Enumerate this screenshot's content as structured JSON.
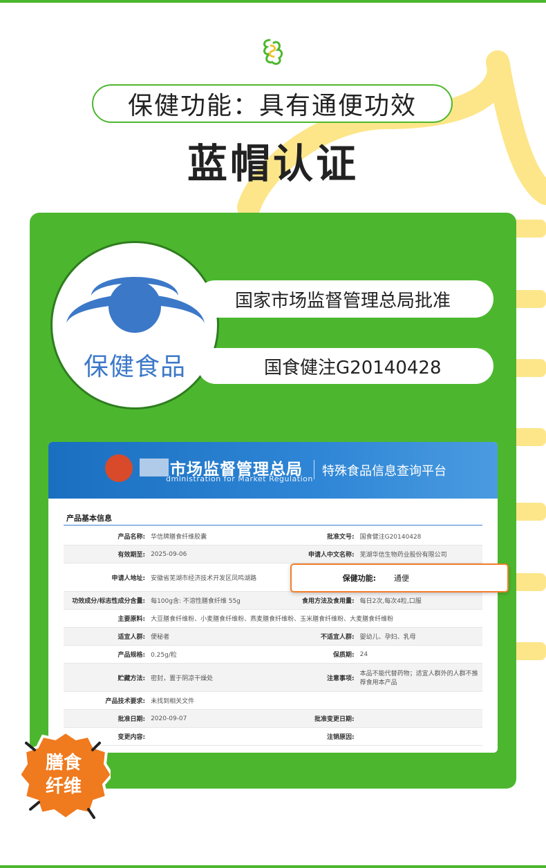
{
  "header": {
    "function_pill": "保健功能：具有通便功效",
    "certification_title": "蓝帽认证"
  },
  "logo": {
    "text": "保健食品",
    "icon": "blue-hat-health-food-icon"
  },
  "approval": {
    "authority": "国家市场监督管理总局批准",
    "registration_no": "国食健注G20140428"
  },
  "screenshot": {
    "agency_name": "市场监督管理总局",
    "agency_en": "dministration for Market Regulation",
    "platform": "特殊食品信息查询平台",
    "section_title": "产品基本信息",
    "rows": [
      {
        "k1": "产品名称:",
        "v1": "华信牌膳食纤维胶囊",
        "k2": "批准文号:",
        "v2": "国食健注G20140428"
      },
      {
        "k1": "有效期至:",
        "v1": "2025-09-06",
        "k2": "申请人中文名称:",
        "v2": "芜湖华信生物药业股份有限公司"
      },
      {
        "k1": "申请人地址:",
        "v1": "安徽省芜湖市经济技术开发区凤鸣湖路",
        "k2": "",
        "v2": ""
      },
      {
        "k1": "功效成分/标志性成分含量:",
        "v1": "每100g含: 不溶性膳食纤维 55g",
        "k2": "食用方法及食用量:",
        "v2": "每日2次,每次4粒,口服"
      },
      {
        "k1": "主要原料:",
        "v1": "大豆膳食纤维粉、小麦膳食纤维粉、燕麦膳食纤维粉、玉米膳食纤维粉、大麦膳食纤维粉",
        "k2": "",
        "v2": ""
      },
      {
        "k1": "适宜人群:",
        "v1": "便秘者",
        "k2": "不适宜人群:",
        "v2": "婴幼儿、孕妇、乳母"
      },
      {
        "k1": "产品规格:",
        "v1": "0.25g/粒",
        "k2": "保质期:",
        "v2": "24"
      },
      {
        "k1": "贮藏方法:",
        "v1": "密封，置于阴凉干燥处",
        "k2": "注意事项:",
        "v2": "本品不能代替药物；适宜人群外的人群不推荐食用本产品"
      },
      {
        "k1": "产品技术要求:",
        "v1": "未找到相关文件",
        "k2": "",
        "v2": ""
      },
      {
        "k1": "批准日期:",
        "v1": "2020-09-07",
        "k2": "批准变更日期:",
        "v2": ""
      },
      {
        "k1": "变更内容:",
        "v1": "",
        "k2": "注销原因:",
        "v2": ""
      }
    ],
    "highlight": {
      "label": "保健功能:",
      "value": "通便"
    }
  },
  "badge": {
    "line1": "膳食",
    "line2": "纤维",
    "color": "#f07a1e"
  },
  "colors": {
    "brand_green": "#4cb72e",
    "accent_yellow": "#fde68a",
    "logo_blue": "#3c78c8"
  }
}
